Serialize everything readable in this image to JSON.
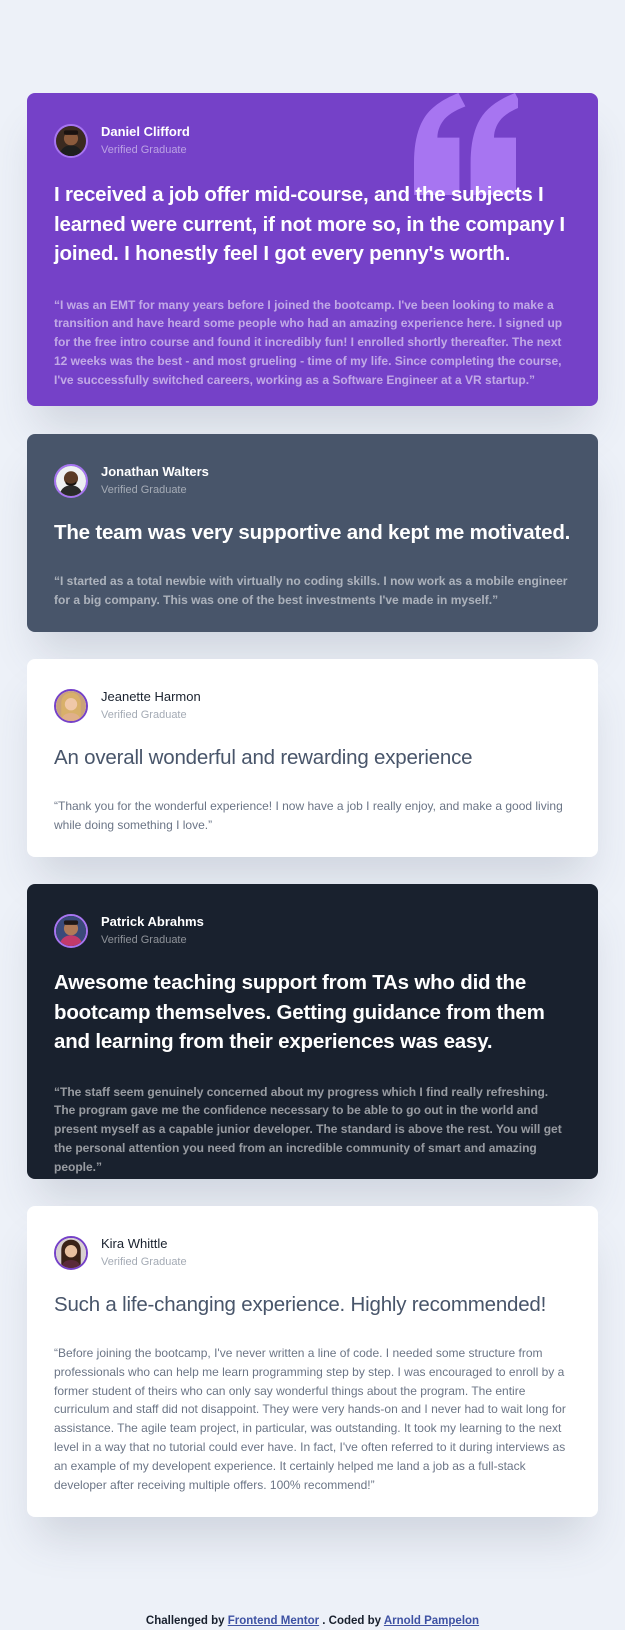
{
  "testimonials": [
    {
      "name": "Daniel Clifford",
      "role": "Verified Graduate",
      "headline": "I received a job offer mid-course, and the subjects I learned were current, if not more so, in the company I joined. I honestly feel I got every penny's worth.",
      "quote": "“I was an EMT for many years before I joined the bootcamp. I've been looking to make a transition and have heard some people who had an amazing experience here. I signed up for the free intro course and found it incredibly fun! I enrolled shortly thereafter. The next 12 weeks was the best - and most grueling - time of my life. Since completing the course, I've successfully switched careers, working as a Software Engineer at a VR startup.”"
    },
    {
      "name": "Jonathan Walters",
      "role": "Verified Graduate",
      "headline": "The team was very supportive and kept me motivated.",
      "quote": "“I started as a total newbie with virtually no coding skills. I now work as a mobile engineer for a big company. This was one of the best investments I've made in myself.”"
    },
    {
      "name": "Jeanette Harmon",
      "role": "Verified Graduate",
      "headline": "An overall wonderful and rewarding experience",
      "quote": "“Thank you for the wonderful experience! I now have a job I really enjoy, and make a good living while doing something I love.”"
    },
    {
      "name": "Patrick Abrahms",
      "role": "Verified Graduate",
      "headline": "Awesome teaching support from TAs who did the bootcamp themselves. Getting guidance from them and learning from their experiences was easy.",
      "quote": "“The staff seem genuinely concerned about my progress which I find really refreshing. The program gave me the confidence necessary to be able to go out in the world and present myself as a capable junior developer. The standard is above the rest. You will get the personal attention you need from an incredible community of smart and amazing people.”"
    },
    {
      "name": "Kira Whittle",
      "role": "Verified Graduate",
      "headline": "Such a life-changing experience. Highly recommended!",
      "quote": "“Before joining the bootcamp, I've never written a line of code. I needed some structure from professionals who can help me learn programming step by step. I was encouraged to enroll by a former student of theirs who can only say wonderful things about the program. The entire curriculum and staff did not disappoint. They were very hands-on and I never had to wait long for assistance. The agile team project, in particular, was outstanding. It took my learning to the next level in a way that no tutorial could ever have. In fact, I've often referred to it during interviews as an example of my developent experience. It certainly helped me land a job as a full-stack developer after receiving multiple offers. 100% recommend!”"
    }
  ],
  "footer": {
    "prefix": "Challenged by",
    "challenge_link": "Frontend Mentor",
    "middle": ". Coded by",
    "author_link": "Arnold Pampelon"
  },
  "colors": {
    "background": "#edf1f8",
    "purple": "#7541c8",
    "slate": "#48556a",
    "dark": "#19212e",
    "quote_mark": "#a775f1"
  },
  "icons": [
    "quotation-mark-icon"
  ]
}
